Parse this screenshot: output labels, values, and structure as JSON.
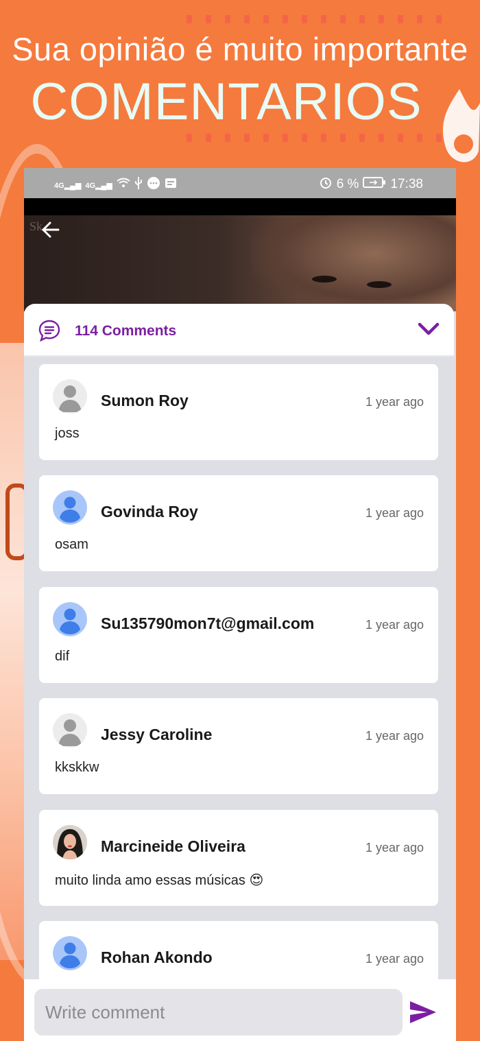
{
  "banner": {
    "headline": "Sua opinião é muito importante",
    "title": "COMENTARIOS"
  },
  "status_bar": {
    "network1": "4G",
    "network2": "4G",
    "battery": "6 %",
    "time": "17:38"
  },
  "hero": {
    "watermark": "Sk"
  },
  "comments_header": {
    "count_label": "114 Comments"
  },
  "comments": [
    {
      "name": "Sumon Roy",
      "time": "1 year ago",
      "text": "joss",
      "avatar": "gray-default-avatar"
    },
    {
      "name": "Govinda Roy",
      "time": "1 year ago",
      "text": "osam",
      "avatar": "blue-default-avatar"
    },
    {
      "name": "Su135790mon7t@gmail.com",
      "time": "1 year ago",
      "text": "dif",
      "avatar": "blue-default-avatar"
    },
    {
      "name": "Jessy Caroline",
      "time": "1 year ago",
      "text": "kkskkw",
      "avatar": "gray-default-avatar"
    },
    {
      "name": "Marcineide Oliveira",
      "time": "1 year ago",
      "text": "muito linda amo essas músicas 😍",
      "avatar": "photo-avatar"
    },
    {
      "name": "Rohan Akondo",
      "time": "1 year ago",
      "text": "",
      "avatar": "blue-default-avatar"
    }
  ],
  "composer": {
    "placeholder": "Write comment"
  },
  "colors": {
    "background": "#f57a3d",
    "accent": "#7b1fa2",
    "status_bar": "#a9a9a9"
  }
}
